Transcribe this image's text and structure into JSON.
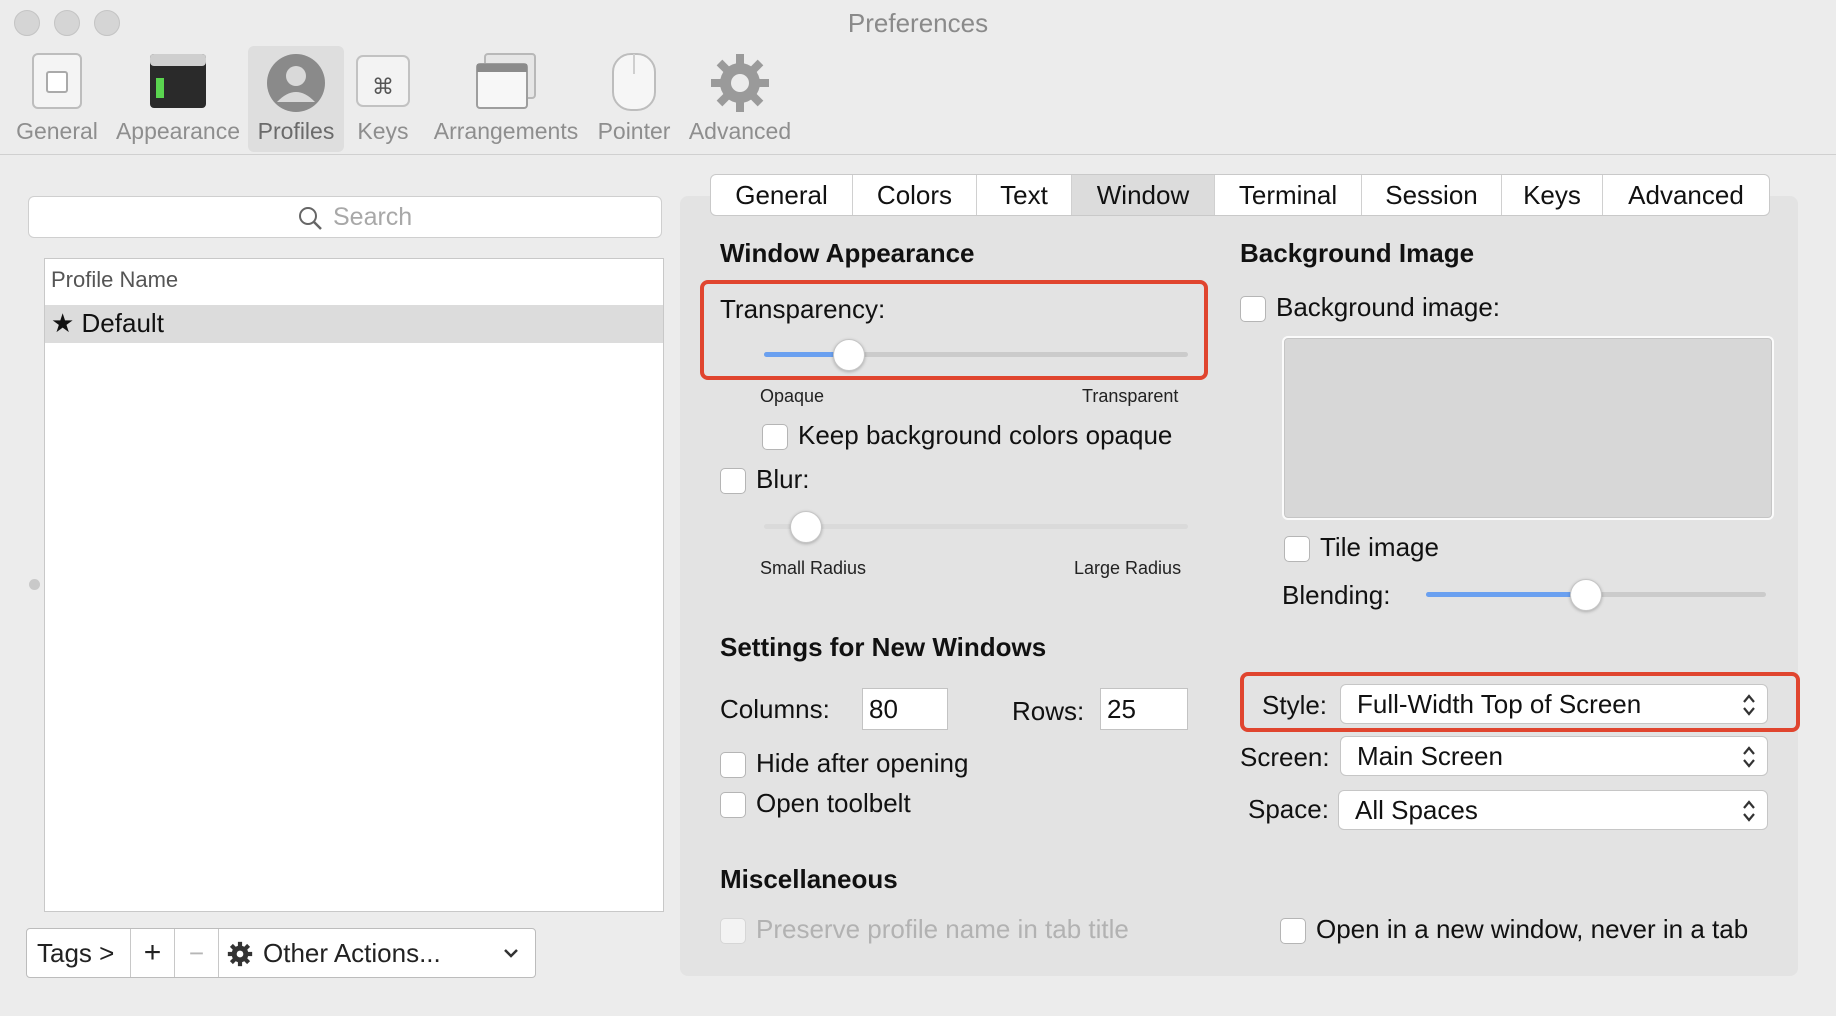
{
  "window": {
    "title": "Preferences"
  },
  "toolbar": {
    "items": [
      {
        "label": "General"
      },
      {
        "label": "Appearance"
      },
      {
        "label": "Profiles"
      },
      {
        "label": "Keys"
      },
      {
        "label": "Arrangements"
      },
      {
        "label": "Pointer"
      },
      {
        "label": "Advanced"
      }
    ],
    "active": "Profiles"
  },
  "profiles": {
    "search_placeholder": "Search",
    "column_header": "Profile Name",
    "rows": [
      {
        "label": "★ Default"
      }
    ],
    "bottom_bar": {
      "tags_label": "Tags >",
      "add_label": "+",
      "remove_label": "−",
      "other_actions_label": "Other Actions..."
    }
  },
  "tabs": {
    "items": [
      "General",
      "Colors",
      "Text",
      "Window",
      "Terminal",
      "Session",
      "Keys",
      "Advanced"
    ],
    "active": "Window"
  },
  "window_appearance": {
    "title": "Window Appearance",
    "transparency_label": "Transparency:",
    "transparency_value": 0.2,
    "opaque_label": "Opaque",
    "transparent_label": "Transparent",
    "keep_bg_opaque_label": "Keep background colors opaque",
    "keep_bg_opaque_checked": false,
    "blur_label": "Blur:",
    "blur_checked": false,
    "blur_value": 0.1,
    "small_radius_label": "Small Radius",
    "large_radius_label": "Large Radius"
  },
  "background_image": {
    "title": "Background Image",
    "checkbox_label": "Background image:",
    "checked": false,
    "tile_label": "Tile image",
    "tile_checked": false,
    "blending_label": "Blending:",
    "blending_value": 0.47
  },
  "new_windows": {
    "title": "Settings for New Windows",
    "columns_label": "Columns:",
    "columns_value": "80",
    "rows_label": "Rows:",
    "rows_value": "25",
    "hide_after_opening_label": "Hide after opening",
    "open_toolbelt_label": "Open toolbelt",
    "style_label": "Style:",
    "style_value": "Full-Width Top of Screen",
    "screen_label": "Screen:",
    "screen_value": "Main Screen",
    "space_label": "Space:",
    "space_value": "All Spaces"
  },
  "misc": {
    "title": "Miscellaneous",
    "preserve_name_label": "Preserve profile name in tab title",
    "open_new_window_label": "Open in a new window, never in a tab"
  },
  "colors": {
    "highlight_border": "#e0452f",
    "slider_fill": "#6aa0f0"
  }
}
